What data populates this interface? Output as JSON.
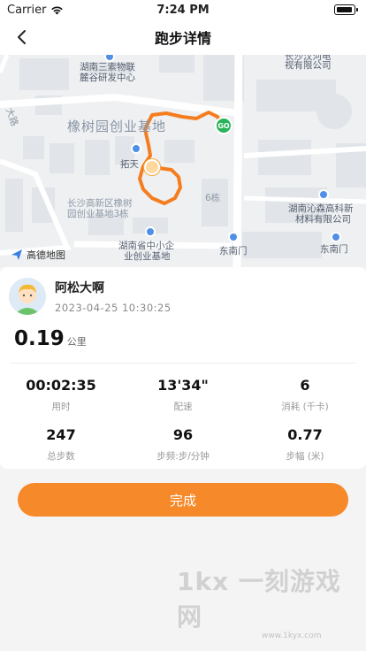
{
  "status_bar": {
    "carrier": "Carrier",
    "time": "7:24 PM"
  },
  "nav": {
    "title": "跑步详情"
  },
  "map": {
    "labels": {
      "label_1": "湖南三索物联",
      "label_2": "麓谷研发中心",
      "label_3": "长沙汉河电",
      "label_4": "视有限公司",
      "label_5": "橡树园创业基地",
      "label_6": "拓天",
      "label_7": "长沙高新区橡树",
      "label_8": "园创业基地3栋",
      "label_9": "6栋",
      "label_10": "湖南沁森高科新",
      "label_11": "材料有限公司",
      "label_12": "湖南省中小企",
      "label_13": "业创业基地",
      "label_14": "东南门",
      "label_15": "东南门",
      "label_16": "大路"
    },
    "start_marker": "GO",
    "brand": "高德地图",
    "route_color": "#f57d1f"
  },
  "profile": {
    "name": "阿松大啊",
    "datetime": "2023-04-25 10:30:25"
  },
  "distance": {
    "value": "0.19",
    "unit": "公里"
  },
  "stats": [
    {
      "value": "00:02:35",
      "label": "用时"
    },
    {
      "value": "13'34\"",
      "label": "配速"
    },
    {
      "value": "6",
      "label": "消耗 (千卡)"
    },
    {
      "value": "247",
      "label": "总步数"
    },
    {
      "value": "96",
      "label": "步频:步/分钟"
    },
    {
      "value": "0.77",
      "label": "步幅 (米)"
    }
  ],
  "done_button": {
    "label": "完成"
  },
  "watermark": {
    "text": "1kx 一刻游戏网",
    "url": "www.1kyx.com"
  },
  "colors": {
    "accent": "#f6892a",
    "start": "#29b35a",
    "poi": "#4f8fe8"
  }
}
